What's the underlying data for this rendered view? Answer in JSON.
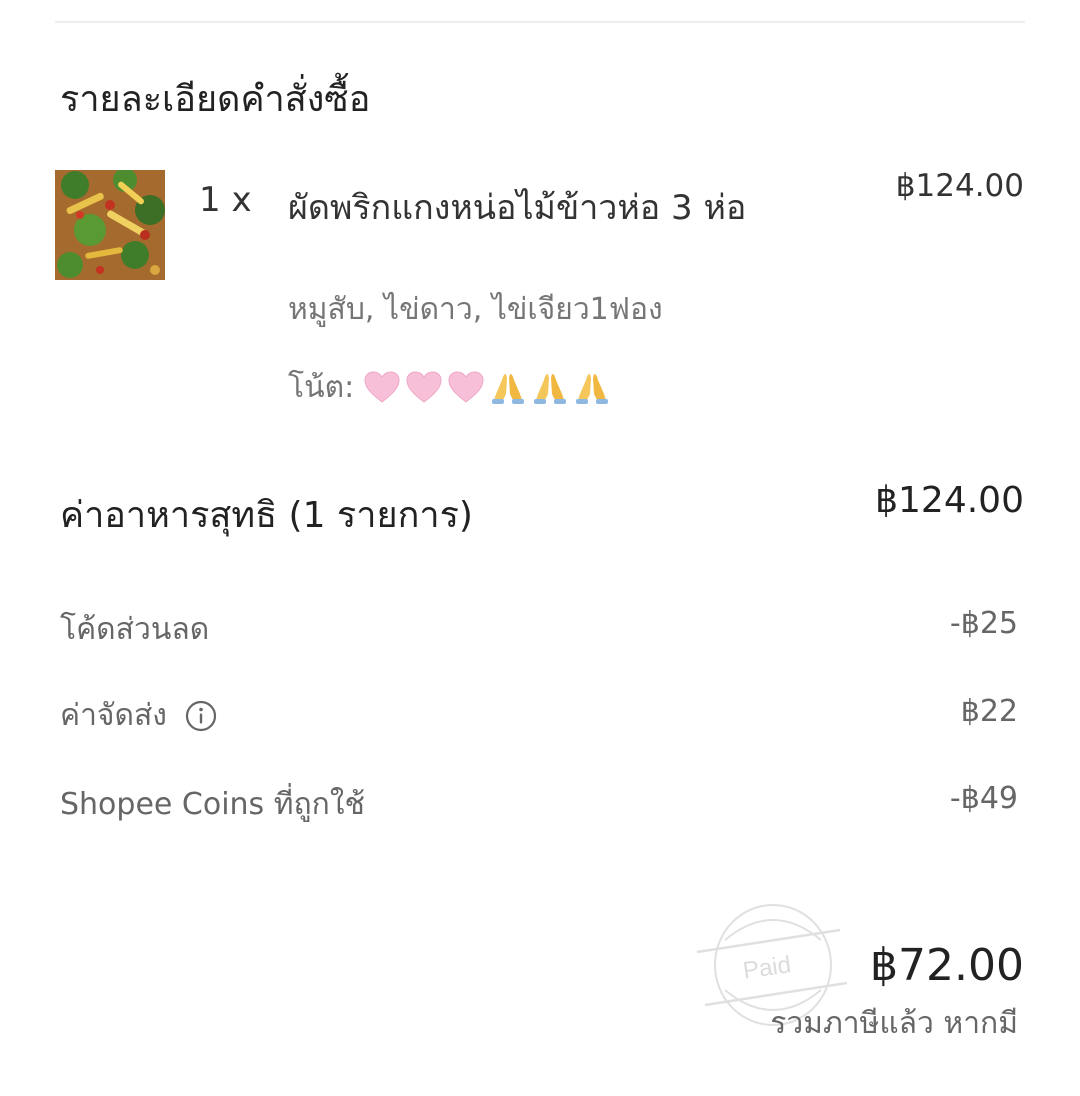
{
  "order_details": {
    "section_title": "รายละเอียดคำสั่งซื้อ",
    "item": {
      "quantity": "1 x",
      "name": "ผัดพริกแกงหน่อไม้ข้าวห่อ 3 ห่อ",
      "price": "฿124.00",
      "options": "หมูสับ, ไข่ดาว, ไข่เจียว1ฟอง",
      "note_label": "โน้ต:",
      "note_emojis": [
        "pink-heart",
        "pink-heart",
        "pink-heart",
        "folded-hands",
        "folded-hands",
        "folded-hands"
      ],
      "image_icon": "food-thumbnail"
    }
  },
  "summary": {
    "subtotal_label": "ค่าอาหารสุทธิ (1 รายการ)",
    "subtotal_value": "฿124.00",
    "discount_label": "โค้ดส่วนลด",
    "discount_value": "-฿25",
    "delivery_label": "ค่าจัดส่ง",
    "delivery_value": "฿22",
    "delivery_icon": "info-icon",
    "coins_label": "Shopee Coins ที่ถูกใช้",
    "coins_value": "-฿49",
    "total_value": "฿72.00",
    "tax_note": "รวมภาษีแล้ว หากมี",
    "stamp_text": "Paid"
  },
  "colors": {
    "primary_text": "#222222",
    "secondary_text": "#757575",
    "divider": "#eeeeee",
    "stamp": "#d9d9d9"
  }
}
